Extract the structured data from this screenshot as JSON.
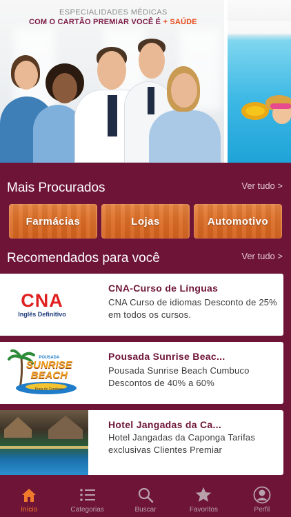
{
  "banner": {
    "subtitle": "ESPECIALIDADES MÉDICAS",
    "title_prefix": "COM O CARTÃO PREMIAR VOCÊ É",
    "title_accent": "+ SAÚDE"
  },
  "most_searched": {
    "title": "Mais Procurados",
    "see_all": "Ver tudo >",
    "categories": [
      "Farmácias",
      "Lojas",
      "Automotivo"
    ]
  },
  "recommended": {
    "title": "Recomendados para você",
    "see_all": "Ver tudo >",
    "items": [
      {
        "title": "CNA-Curso de Línguas",
        "description": "CNA Curso de idiomas Desconto de 25% em todos os cursos.",
        "logo_text": "CNA",
        "logo_subtext": "Inglês Definitivo"
      },
      {
        "title": "Pousada Sunrise Beac...",
        "description": "Pousada Sunrise Beach Cumbuco Descontos de 40% a 60%",
        "logo_top": "POUSADA",
        "logo_line1": "SUNRISE",
        "logo_line2": "BEACH",
        "logo_sub": "Praia do Cumbuco"
      },
      {
        "title": "Hotel Jangadas da Ca...",
        "description": "Hotel Jangadas da Caponga Tarifas exclusivas Clientes Premiar"
      }
    ]
  },
  "tabbar": {
    "tabs": [
      {
        "label": "Início",
        "icon": "home-icon",
        "active": true
      },
      {
        "label": "Categorias",
        "icon": "list-icon",
        "active": false
      },
      {
        "label": "Buscar",
        "icon": "search-icon",
        "active": false
      },
      {
        "label": "Favoritos",
        "icon": "star-icon",
        "active": false
      },
      {
        "label": "Perfil",
        "icon": "profile-icon",
        "active": false
      }
    ]
  },
  "colors": {
    "brand": "#6e1437",
    "accent": "#e47a32",
    "tab_active": "#f07a2c"
  }
}
